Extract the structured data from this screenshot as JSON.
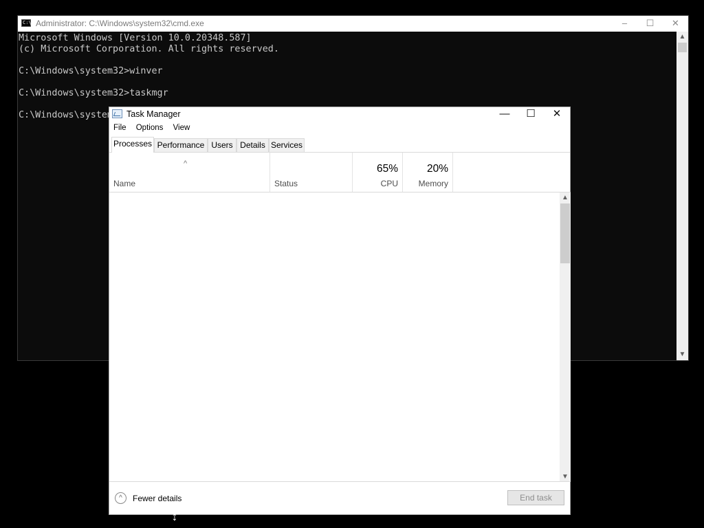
{
  "cmd": {
    "title": "Administrator: C:\\Windows\\system32\\cmd.exe",
    "icon": "C:\\",
    "controls": {
      "minimize": "–",
      "maximize": "☐",
      "close": "✕"
    },
    "lines": [
      "Microsoft Windows [Version 10.0.20348.587]",
      "(c) Microsoft Corporation. All rights reserved.",
      "",
      "C:\\Windows\\system32>winver",
      "",
      "C:\\Windows\\system32>taskmgr",
      "",
      "C:\\Windows\\system32>"
    ]
  },
  "taskmanager": {
    "title": "Task Manager",
    "controls": {
      "minimize": "—",
      "maximize": "☐",
      "close": "✕"
    },
    "menu": [
      "File",
      "Options",
      "View"
    ],
    "tabs": [
      "Processes",
      "Performance",
      "Users",
      "Details",
      "Services"
    ],
    "active_tab": "Processes",
    "columns": {
      "name": "Name",
      "status": "Status",
      "cpu": {
        "percent": "65%",
        "label": "CPU"
      },
      "memory": {
        "percent": "20%",
        "label": "Memory"
      }
    },
    "sort_indicator": "^",
    "footer": {
      "fewer_details": "Fewer details",
      "fewer_icon": "^",
      "end_task": "End task"
    }
  },
  "cursor": "↕"
}
